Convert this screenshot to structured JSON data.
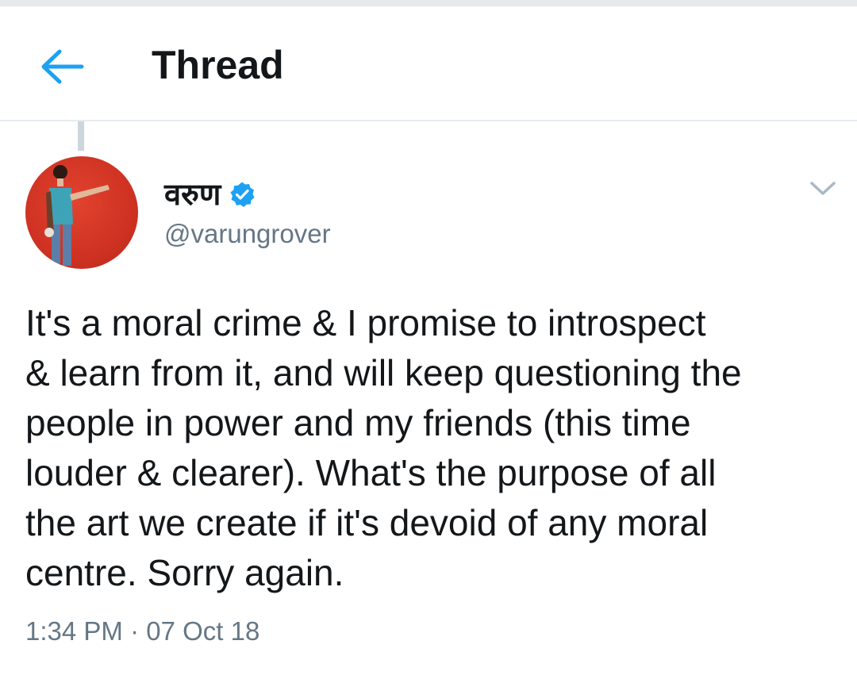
{
  "header": {
    "title": "Thread",
    "back_icon": "arrow-left-icon",
    "accent_color": "#1da1f2"
  },
  "tweet": {
    "author": {
      "name": "वरुण",
      "handle": "@varungrover",
      "verified": true,
      "verified_icon": "verified-badge-icon"
    },
    "menu_icon": "chevron-down-icon",
    "text_lines": [
      "It's a moral crime & I promise to introspect",
      "& learn from it, and will keep questioning the",
      "people in power and my friends (this time",
      "louder & clearer). What's the purpose of all",
      "the art we create if it's devoid of any moral",
      "centre. Sorry again."
    ],
    "timestamp": "1:34 PM · 07 Oct 18"
  }
}
